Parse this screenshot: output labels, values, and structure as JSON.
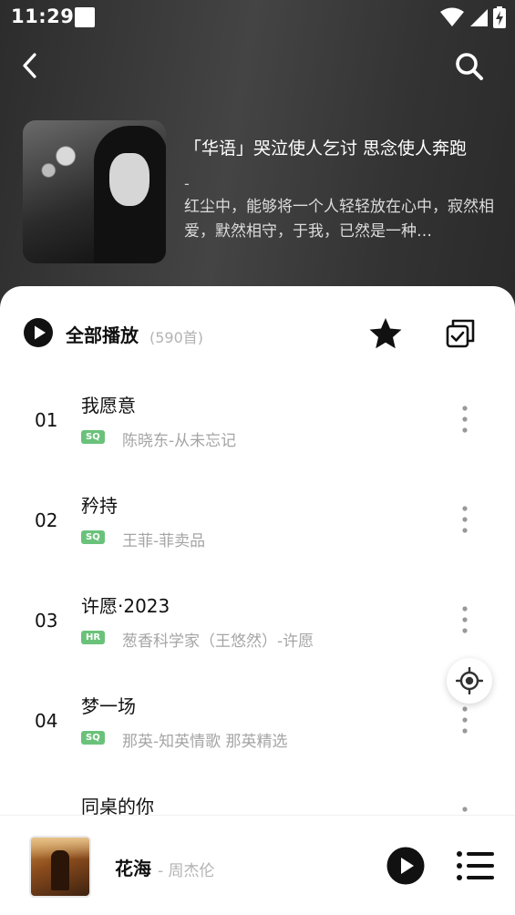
{
  "status_bar": {
    "time": "11:29"
  },
  "playlist": {
    "title": "「华语」哭泣使人乞讨 思念使人奔跑",
    "dash": "-",
    "description": "红尘中，能够将一个人轻轻放在心中，寂然相爱，默然相守，于我，已然是一种…"
  },
  "actions": {
    "play_all_label": "全部播放",
    "play_all_count": "(590首)"
  },
  "songs": [
    {
      "index": "01",
      "title": "我愿意",
      "badge": "SQ",
      "subtitle": "陈晓东-从未忘记"
    },
    {
      "index": "02",
      "title": "矜持",
      "badge": "SQ",
      "subtitle": "王菲-菲卖品"
    },
    {
      "index": "03",
      "title": "许愿·2023",
      "badge": "HR",
      "subtitle": "葱香科学家（王悠然）-许愿"
    },
    {
      "index": "04",
      "title": "梦一场",
      "badge": "SQ",
      "subtitle": "那英-知英情歌 那英精选"
    },
    {
      "index": "",
      "title": "同桌的你",
      "badge": "",
      "subtitle": ""
    }
  ],
  "now_playing": {
    "title": "花海",
    "artist": "- 周杰伦"
  },
  "colors": {
    "badge_green": "#6ac27a",
    "header_dark": "#3a3a3a",
    "accent_black": "#111111"
  },
  "icons": {
    "back": "chevron-left-icon",
    "search": "search-icon",
    "play_all": "play-circle-icon",
    "favorite": "star-icon",
    "multi_select": "multi-select-icon",
    "more": "more-vertical-icon",
    "locate": "locate-icon",
    "play": "play-icon",
    "queue": "playlist-icon"
  }
}
